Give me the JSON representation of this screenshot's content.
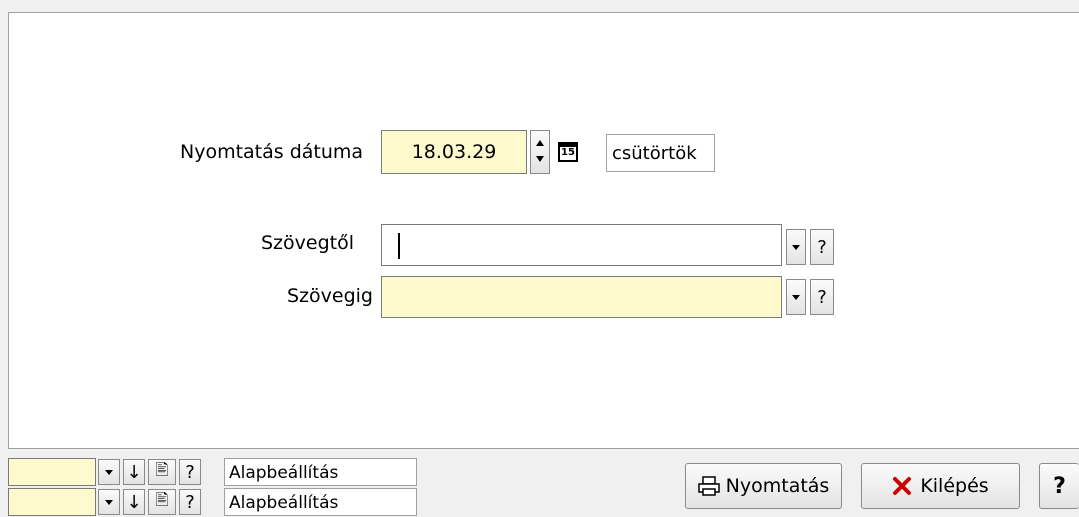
{
  "form": {
    "date_label": "Nyomtatás dátuma",
    "date_value": "18.03.29",
    "calendar_icon_text": "15",
    "weekday": "csütörtök",
    "from_label": "Szövegtől",
    "from_value": "",
    "to_label": "Szövegig",
    "to_value": "",
    "help_glyph": "?"
  },
  "settings_rows": [
    {
      "name": "Alapbeállítás"
    },
    {
      "name": "Alapbeállítás"
    }
  ],
  "buttons": {
    "print_label": "Nyomtatás",
    "exit_label": "Kilépés",
    "help_label": "?"
  },
  "colors": {
    "required_field": "#fffacd",
    "exit_icon": "#cc0000"
  }
}
